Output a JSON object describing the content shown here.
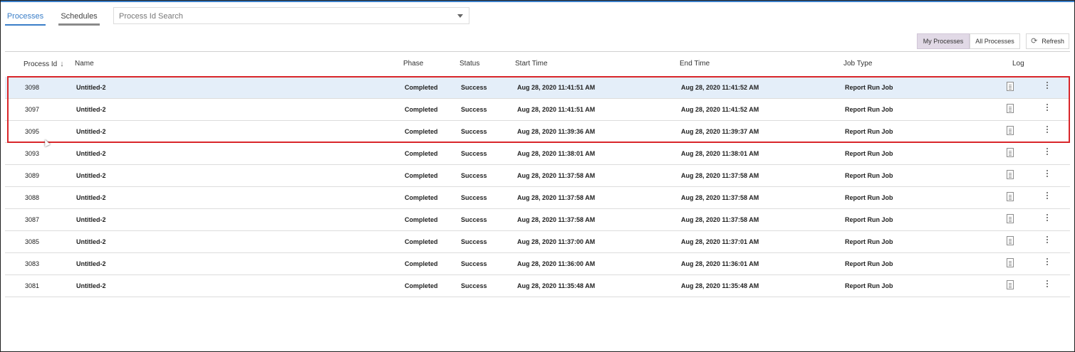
{
  "tabs": [
    {
      "label": "Processes"
    },
    {
      "label": "Schedules"
    }
  ],
  "search": {
    "placeholder": "Process Id Search"
  },
  "view_toggle": {
    "my_label": "My Processes",
    "all_label": "All Processes"
  },
  "refresh": {
    "label": "Refresh",
    "icon": "refresh-icon"
  },
  "table": {
    "headers": {
      "process_id": "Process Id",
      "name": "Name",
      "phase": "Phase",
      "status": "Status",
      "start_time": "Start Time",
      "end_time": "End Time",
      "job_type": "Job Type",
      "log": "Log"
    },
    "sort_icon": "↓",
    "rows": [
      {
        "id": "3098",
        "name": "Untitled-2",
        "phase": "Completed",
        "status": "Success",
        "start": "Aug 28, 2020 11:41:51 AM",
        "end": "Aug 28, 2020 11:41:52 AM",
        "job_type": "Report Run Job"
      },
      {
        "id": "3097",
        "name": "Untitled-2",
        "phase": "Completed",
        "status": "Success",
        "start": "Aug 28, 2020 11:41:51 AM",
        "end": "Aug 28, 2020 11:41:52 AM",
        "job_type": "Report Run Job"
      },
      {
        "id": "3095",
        "name": "Untitled-2",
        "phase": "Completed",
        "status": "Success",
        "start": "Aug 28, 2020 11:39:36 AM",
        "end": "Aug 28, 2020 11:39:37 AM",
        "job_type": "Report Run Job"
      },
      {
        "id": "3093",
        "name": "Untitled-2",
        "phase": "Completed",
        "status": "Success",
        "start": "Aug 28, 2020 11:38:01 AM",
        "end": "Aug 28, 2020 11:38:01 AM",
        "job_type": "Report Run Job"
      },
      {
        "id": "3089",
        "name": "Untitled-2",
        "phase": "Completed",
        "status": "Success",
        "start": "Aug 28, 2020 11:37:58 AM",
        "end": "Aug 28, 2020 11:37:58 AM",
        "job_type": "Report Run Job"
      },
      {
        "id": "3088",
        "name": "Untitled-2",
        "phase": "Completed",
        "status": "Success",
        "start": "Aug 28, 2020 11:37:58 AM",
        "end": "Aug 28, 2020 11:37:58 AM",
        "job_type": "Report Run Job"
      },
      {
        "id": "3087",
        "name": "Untitled-2",
        "phase": "Completed",
        "status": "Success",
        "start": "Aug 28, 2020 11:37:58 AM",
        "end": "Aug 28, 2020 11:37:58 AM",
        "job_type": "Report Run Job"
      },
      {
        "id": "3085",
        "name": "Untitled-2",
        "phase": "Completed",
        "status": "Success",
        "start": "Aug 28, 2020 11:37:00 AM",
        "end": "Aug 28, 2020 11:37:01 AM",
        "job_type": "Report Run Job"
      },
      {
        "id": "3083",
        "name": "Untitled-2",
        "phase": "Completed",
        "status": "Success",
        "start": "Aug 28, 2020 11:36:00 AM",
        "end": "Aug 28, 2020 11:36:01 AM",
        "job_type": "Report Run Job"
      },
      {
        "id": "3081",
        "name": "Untitled-2",
        "phase": "Completed",
        "status": "Success",
        "start": "Aug 28, 2020 11:35:48 AM",
        "end": "Aug 28, 2020 11:35:48 AM",
        "job_type": "Report Run Job"
      }
    ]
  },
  "colors": {
    "accent": "#3a7ec8",
    "selected_row": "#e4eef9",
    "highlight_box": "#d9262a",
    "active_toggle": "#e1d9e6"
  }
}
